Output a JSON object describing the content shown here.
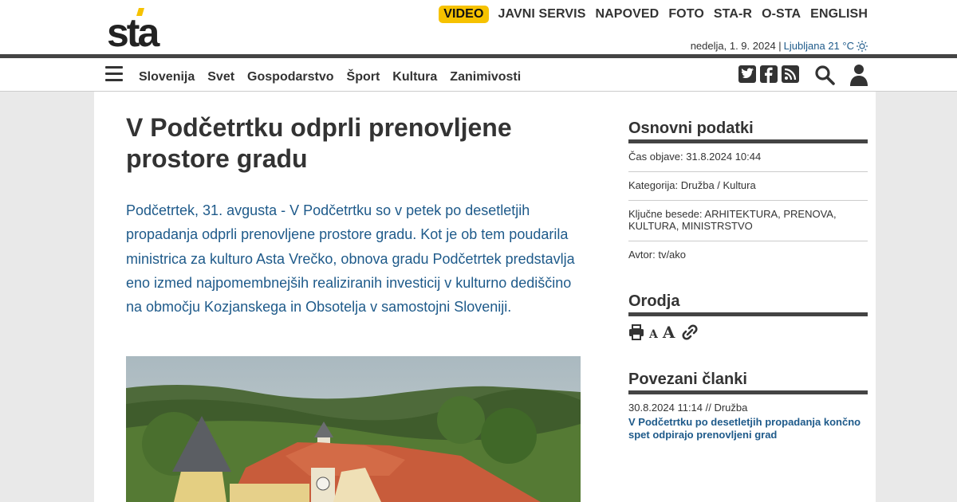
{
  "header": {
    "logo_text": "sta",
    "top_nav": [
      "VIDEO",
      "JAVNI SERVIS",
      "NAPOVED",
      "FOTO",
      "STA-R",
      "O-STA",
      "ENGLISH"
    ],
    "date": "nedelja, 1. 9. 2024 |",
    "weather": "Ljubljana 21 °C"
  },
  "nav": {
    "items": [
      "Slovenija",
      "Svet",
      "Gospodarstvo",
      "Šport",
      "Kultura",
      "Zanimivosti"
    ],
    "icons": [
      "menu-icon",
      "twitter-icon",
      "facebook-icon",
      "rss-icon",
      "search-icon",
      "user-icon"
    ]
  },
  "article": {
    "title": "V Podčetrtku odprli prenovljene prostore gradu",
    "lead": "Podčetrtek, 31. avgusta - V Podčetrtku so v petek po desetletjih propadanja odprli prenovljene prostore gradu. Kot je ob tem poudarila ministrica za kulturo Asta Vrečko, obnova gradu Podčetrtek predstavlja eno izmed najpomembnejših realiziranih investicij v kulturno dediščino na območju Kozjanskega in Obsotelja v samostojni Sloveniji."
  },
  "sidebar": {
    "basic_title": "Osnovni podatki",
    "meta": [
      "Čas objave: 31.8.2024 10:44",
      "Kategorija: Družba / Kultura",
      "Ključne besede: ARHITEKTURA, PRENOVA, KULTURA, MINISTRSTVO",
      "Avtor: tv/ako"
    ],
    "tools_title": "Orodja",
    "tool_small_a": "A",
    "tool_large_a": "A",
    "related_title": "Povezani članki",
    "related": {
      "date": "30.8.2024 11:14 // Družba",
      "link": "V Podčetrtku po desetletjih propadanja končno spet odpirajo prenovljeni grad"
    }
  },
  "colors": {
    "accent_yellow": "#f6c200",
    "link_blue": "#1e5a8a",
    "dark": "#333333"
  }
}
